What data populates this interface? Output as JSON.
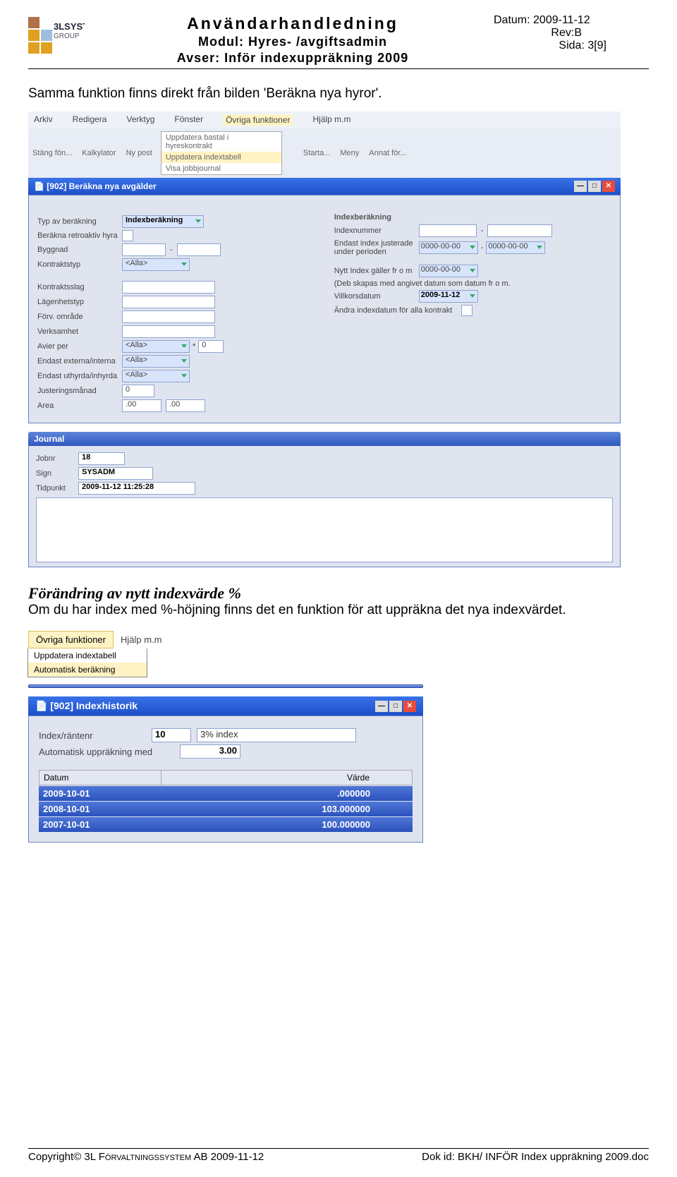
{
  "header": {
    "title": "Användarhandledning",
    "module_label": "Modul:",
    "module_value": "Hyres- /avgiftsadmin",
    "avser_label": "Avser:",
    "avser_value": "Inför indexuppräkning 2009",
    "datum_label": "Datum:",
    "datum_value": "2009-11-12",
    "rev_label": "Rev:",
    "rev_value": "B",
    "sida_label": "Sida:",
    "sida_value": "3[9]"
  },
  "intro_text": "Samma funktion finns direkt från bilden 'Beräkna nya hyror'.",
  "screenshot1": {
    "menus": [
      "Arkiv",
      "Redigera",
      "Verktyg",
      "Fönster",
      "Övriga funktioner",
      "Hjälp m.m"
    ],
    "dropdown": [
      "Uppdatera bastal i hyreskontrakt",
      "Uppdatera indextabell",
      "Visa jobbjournal"
    ],
    "tb_left": [
      "Stäng  fön...",
      "Kalkylator",
      "Ny post"
    ],
    "tb_right": [
      "Starta...",
      "",
      "Meny",
      "Annat  för..."
    ],
    "win_title": "[902]  Beräkna nya avgälder",
    "left_fields": {
      "typ_label": "Typ av beräkning",
      "typ_value": "Indexberäkning",
      "retro_label": "Beräkna retroaktiv hyra",
      "byggnad_label": "Byggnad",
      "kontraktstyp_label": "Kontraktstyp",
      "alla": "<Alla>",
      "kontraktsslag_label": "Kontraktsslag",
      "lagenhet_label": "Lägenhetstyp",
      "omrade_label": "Förv. område",
      "verksamhet_label": "Verksamhet",
      "avier_label": "Avier per",
      "avier_star": "*",
      "avier_value": "0",
      "extint_label": "Endast externa/interna",
      "uthyrda_label": "Endast uthyrda/inhyrda",
      "justering_label": "Justeringsmånad",
      "justering_value": "0",
      "area_label": "Area",
      "area_v1": ".00",
      "area_v2": ".00"
    },
    "right_fields": {
      "head": "Indexberäkning",
      "indexnr_label": "Indexnummer",
      "dash": "-",
      "justerade_label": "Endast index justerade under perioden",
      "d0": "0000-00-00",
      "nytt_label": "Nytt Index gäller fr o m",
      "deb_label": "(Deb skapas med angivet datum som datum fr o m.",
      "vilkor_label": "Villkorsdatum",
      "vilkor_value": "2009-11-12",
      "andra_label": "Ändra indexdatum för alla kontrakt"
    },
    "journal": {
      "head": "Journal",
      "jobnr_label": "Jobnr",
      "jobnr_value": "18",
      "sign_label": "Sign",
      "sign_value": "SYSADM",
      "tid_label": "Tidpunkt",
      "tid_value": "2009-11-12 11:25:28"
    }
  },
  "sect2_title": "Förändring av  nytt indexvärde %",
  "sect2_text": "Om du har index med %-höjning finns det en funktion för att uppräkna det nya indexvärdet.",
  "screenshot2": {
    "menu1": "Övriga funktioner",
    "menu2": "Hjälp m.m",
    "dd": [
      "Uppdatera indextabell",
      "Automatisk beräkning"
    ],
    "win_title": "[902]  Indexhistorik",
    "idx_label": "Index/räntenr",
    "idx_value": "10",
    "idx_desc": "3% index",
    "auto_label": "Automatisk uppräkning med",
    "auto_value": "3.00",
    "col1": "Datum",
    "col2": "Värde",
    "rows": [
      {
        "d": "2009-10-01",
        "v": ".000000"
      },
      {
        "d": "2008-10-01",
        "v": "103.000000"
      },
      {
        "d": "2007-10-01",
        "v": "100.000000"
      }
    ]
  },
  "footer": {
    "left_pre": "Copyright© 3L ",
    "left_sc": "Förvaltningssystem",
    "left_post": " AB 2009-11-12",
    "right": "Dok id: BKH/ INFÖR Index uppräkning 2009.doc"
  }
}
